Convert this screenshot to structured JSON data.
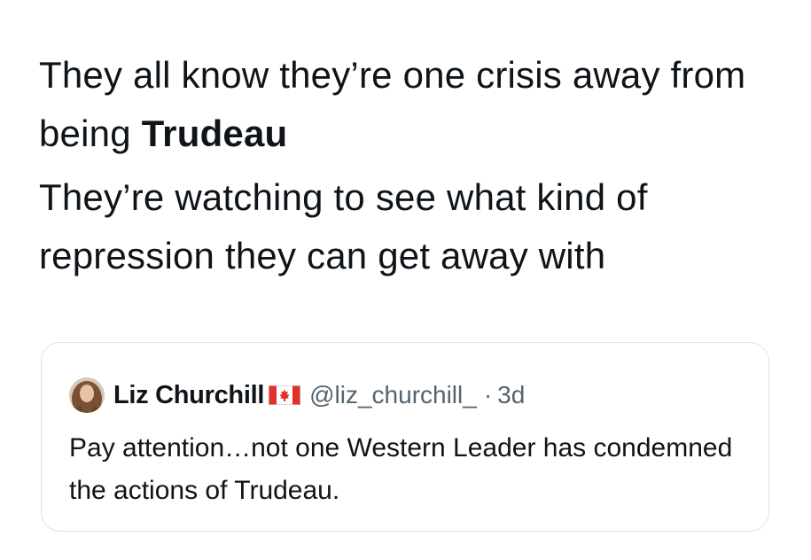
{
  "tweet": {
    "paragraph1_before": "They all know they’re one crisis away from being ",
    "paragraph1_bold": "Trudeau",
    "paragraph2": "They’re watching to see what kind of repression they can get away with"
  },
  "quoted_tweet": {
    "display_name": "Liz Churchill",
    "flag_icon": "canada-flag-icon",
    "handle": "@liz_churchill_",
    "separator": "·",
    "time": "3d",
    "text": "Pay attention…not one Western Leader has condemned the actions of Trudeau."
  },
  "colors": {
    "text_primary": "#0f1419",
    "text_secondary": "#536471",
    "card_border": "#dfe3e7",
    "flag_red": "#e0312b"
  }
}
